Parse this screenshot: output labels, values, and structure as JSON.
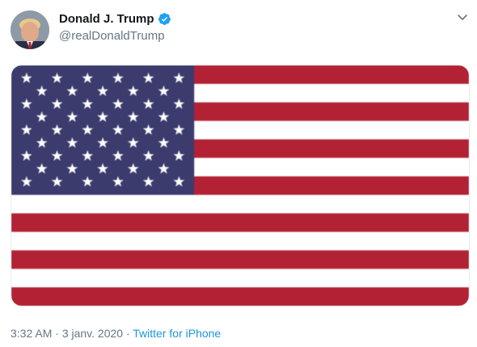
{
  "author": {
    "display_name": "Donald J. Trump",
    "handle": "@realDonaldTrump",
    "verified": true
  },
  "media": {
    "description_icon": "us-flag-icon",
    "colors": {
      "red": "#b22234",
      "white": "#ffffff",
      "blue": "#3c3b6e"
    }
  },
  "meta": {
    "time": "3:32 AM",
    "separator_1": " · ",
    "date": "3 janv. 2020",
    "separator_2": " · ",
    "source": "Twitter for iPhone"
  },
  "icons": {
    "verified": "verified-badge-icon",
    "menu": "chevron-down-icon"
  },
  "colors": {
    "link": "#1b95e0",
    "secondary_text": "#657786",
    "primary_text": "#14171a",
    "verified_blue": "#1da1f2"
  }
}
